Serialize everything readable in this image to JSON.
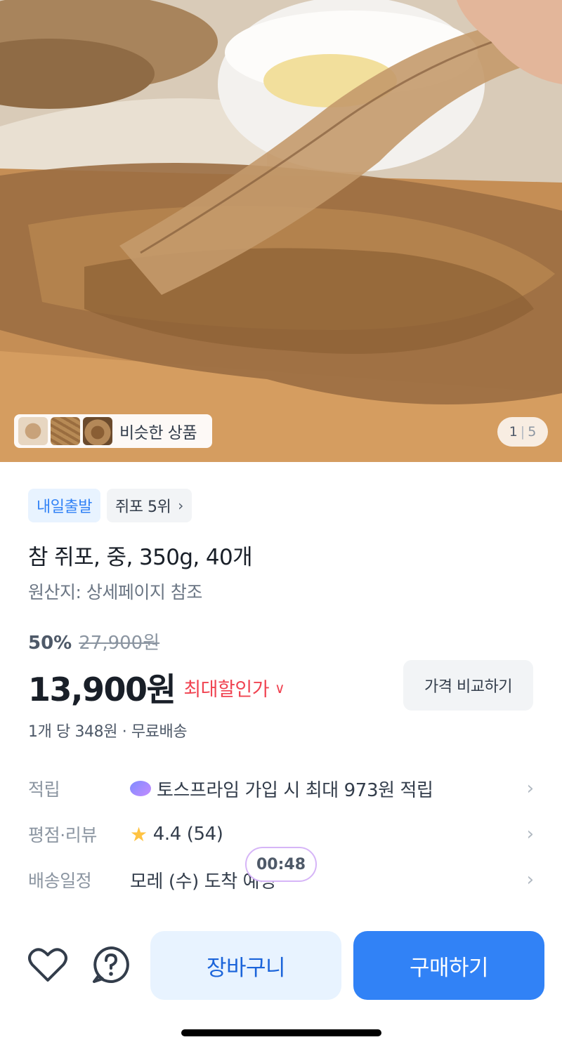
{
  "hero": {
    "similar_label": "비슷한 상품",
    "page_current": "1",
    "page_separator": "|",
    "page_total": "5"
  },
  "tags": {
    "shipping": "내일출발",
    "ranking": "쥐포 5위"
  },
  "product": {
    "title": "참 쥐포, 중, 350g, 40개",
    "origin": "원산지: 상세페이지 참조",
    "discount_rate": "50%",
    "original_price": "27,900원",
    "price": "13,900원",
    "max_discount_label": "최대할인가",
    "compare_button": "가격 비교하기",
    "unit_price": "1개 당 348원 · 무료배송"
  },
  "info": {
    "points_key": "적립",
    "points_value": "토스프라임 가입 시 최대 973원 적립",
    "rating_key": "평점·리뷰",
    "rating_value": "4.4 (54)",
    "delivery_key": "배송일정",
    "delivery_value": "모레 (수) 도착 예정"
  },
  "timer": "00:48",
  "bottom": {
    "cart_button": "장바구니",
    "buy_button": "구매하기"
  },
  "icons": {
    "heart": "heart-icon",
    "help": "question-circle-icon",
    "star": "star-icon",
    "prime": "toss-prime-icon",
    "chevron": "chevron-right-icon"
  },
  "colors": {
    "primary": "#3182f6",
    "primary_light": "#e8f3ff",
    "discount_red": "#f04452",
    "star": "#ffc342"
  }
}
